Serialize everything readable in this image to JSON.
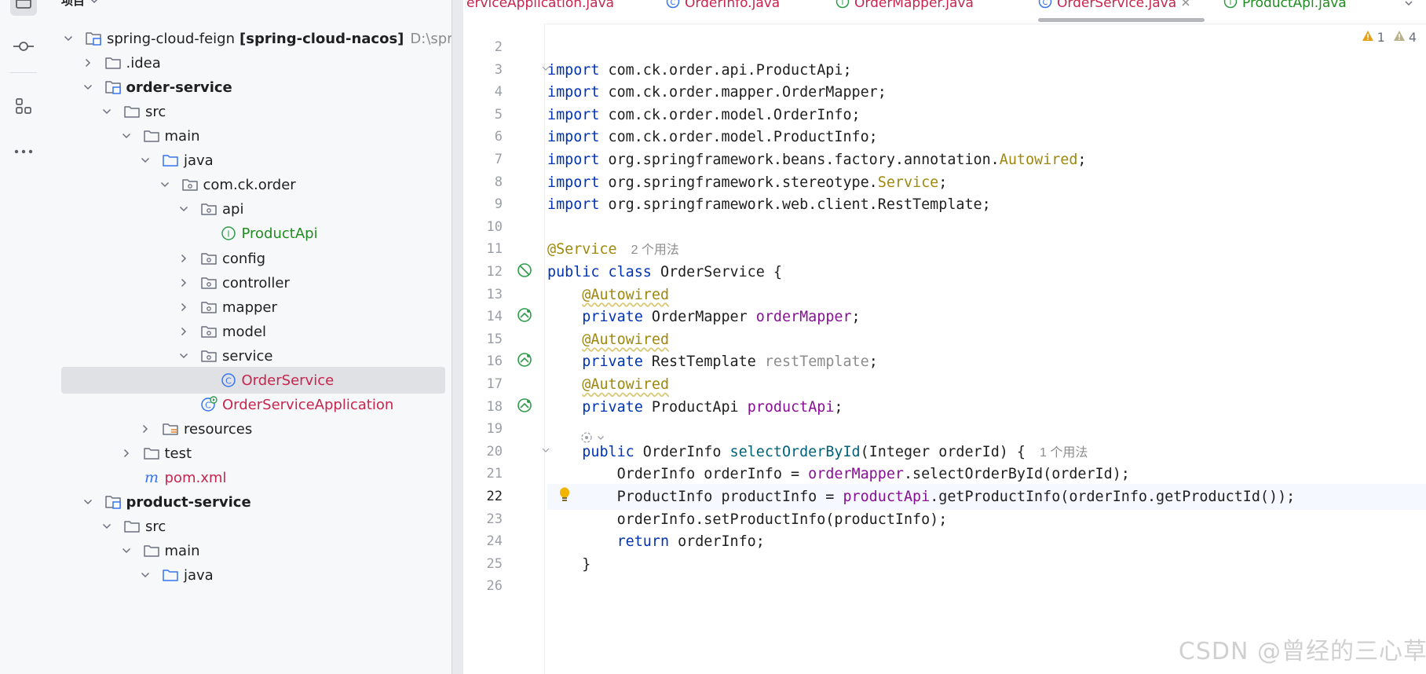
{
  "toolstrip": {
    "icons": [
      "project-icon",
      "commit-icon",
      "structure-icon",
      "more-icon"
    ]
  },
  "panel": {
    "title": "项目",
    "tree": [
      {
        "label": "spring-cloud-feign",
        "extra": "[spring-cloud-nacos]",
        "path": "D:\\spring-",
        "icon": "module"
      },
      {
        "label": ".idea",
        "icon": "folder"
      },
      {
        "label": "order-service",
        "icon": "module"
      },
      {
        "label": "src",
        "icon": "folder"
      },
      {
        "label": "main",
        "icon": "folder"
      },
      {
        "label": "java",
        "icon": "src-folder"
      },
      {
        "label": "com.ck.order",
        "icon": "package"
      },
      {
        "label": "api",
        "icon": "package"
      },
      {
        "label": "ProductApi",
        "icon": "interface"
      },
      {
        "label": "config",
        "icon": "package"
      },
      {
        "label": "controller",
        "icon": "package"
      },
      {
        "label": "mapper",
        "icon": "package"
      },
      {
        "label": "model",
        "icon": "package"
      },
      {
        "label": "service",
        "icon": "package"
      },
      {
        "label": "OrderService",
        "icon": "class"
      },
      {
        "label": "OrderServiceApplication",
        "icon": "spring-class"
      },
      {
        "label": "resources",
        "icon": "resources-folder"
      },
      {
        "label": "test",
        "icon": "folder"
      },
      {
        "label": "pom.xml",
        "icon": "maven"
      },
      {
        "label": "product-service",
        "icon": "module"
      },
      {
        "label": "src",
        "icon": "folder"
      },
      {
        "label": "main",
        "icon": "folder"
      },
      {
        "label": "java",
        "icon": "src-folder"
      }
    ]
  },
  "tabs": [
    {
      "name": "erviceApplication.java",
      "color": "#c7254e"
    },
    {
      "name": "OrderInfo.java",
      "color": "#c7254e"
    },
    {
      "name": "OrderMapper.java",
      "color": "#c7254e"
    },
    {
      "name": "OrderService.java",
      "color": "#c7254e"
    },
    {
      "name": "ProductApi.java",
      "color": "#228b22"
    }
  ],
  "inspections": {
    "warnings": "1",
    "weak_warnings": "4"
  },
  "editor": {
    "line_numbers": [
      "2",
      "3",
      "4",
      "5",
      "6",
      "7",
      "8",
      "9",
      "10",
      "11",
      "12",
      "13",
      "14",
      "15",
      "16",
      "17",
      "18",
      "19",
      "20",
      "21",
      "22",
      "23",
      "24",
      "25",
      "26"
    ],
    "code": {
      "l3": {
        "kw": "import",
        "rest": " com.ck.order.api.ProductApi;"
      },
      "l4": {
        "kw": "import",
        "rest": " com.ck.order.mapper.OrderMapper;"
      },
      "l5": {
        "kw": "import",
        "rest": " com.ck.order.model.OrderInfo;"
      },
      "l6": {
        "kw": "import",
        "rest": " com.ck.order.model.ProductInfo;"
      },
      "l7": {
        "kw": "import",
        "pre": " org.springframework.beans.factory.annotation.",
        "ann": "Autowired",
        "post": ";"
      },
      "l8": {
        "kw": "import",
        "pre": " org.springframework.stereotype.",
        "ann": "Service",
        "post": ";"
      },
      "l9": {
        "kw": "import",
        "rest": " org.springframework.web.client.RestTemplate;"
      },
      "l11": {
        "ann": "@Service",
        "hint": "2 个用法"
      },
      "l12": {
        "kw": "public class",
        "rest": " OrderService {"
      },
      "l13": {
        "ann": "@Autowired"
      },
      "l14": {
        "kw": "private",
        "type": " OrderMapper ",
        "field": "orderMapper",
        "post": ";"
      },
      "l15": {
        "ann": "@Autowired"
      },
      "l16": {
        "kw": "private",
        "type": " RestTemplate ",
        "field": "restTemplate",
        "post": ";"
      },
      "l17": {
        "ann": "@Autowired"
      },
      "l18": {
        "kw": "private",
        "type": " ProductApi ",
        "field": "productApi",
        "post": ";"
      },
      "l20": {
        "kw": "public",
        "type": " OrderInfo ",
        "method": "selectOrderById",
        "params": "(Integer orderId) {",
        "hint": "1 个用法"
      },
      "l21": {
        "pre": "OrderInfo orderInfo = ",
        "field": "orderMapper",
        "post": ".selectOrderById(orderId);"
      },
      "l22": {
        "pre": "ProductInfo productInfo = ",
        "field": "productApi",
        "post": ".getProductInfo(orderInfo.getProductId());"
      },
      "l23": {
        "rest": "orderInfo.setProductInfo(productInfo);"
      },
      "l24": {
        "kw": "return",
        "rest": " orderInfo;"
      },
      "l25": {
        "rest": "}"
      }
    }
  },
  "watermark": "CSDN @曾经的三心草"
}
